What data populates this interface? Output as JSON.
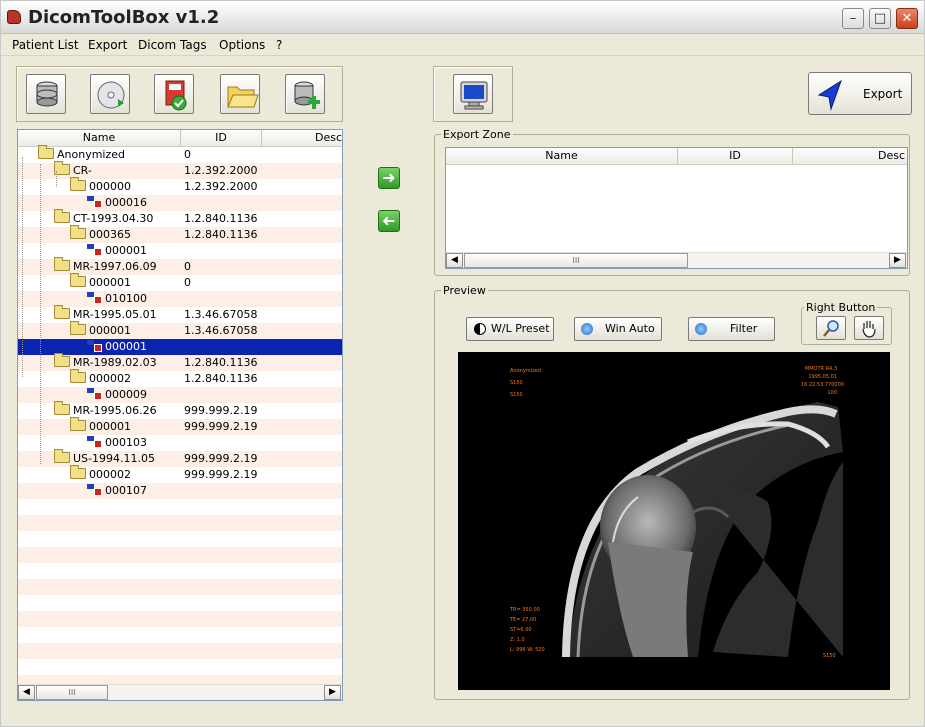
{
  "window": {
    "title": "DicomToolBox v1.2"
  },
  "menu": [
    "Patient List",
    "Export",
    "Dicom Tags",
    "Options",
    "?"
  ],
  "toolbar_icons": [
    "database-icon",
    "cd-icon",
    "import-icon",
    "folder-icon",
    "add-database-icon"
  ],
  "tree": {
    "columns": [
      "Name",
      "ID",
      "Desc"
    ],
    "rows": [
      {
        "name": "Anonymized",
        "id": "0",
        "type": "folder",
        "level": 0
      },
      {
        "name": "CR-",
        "id": "1.2.392.2000...",
        "type": "folder",
        "level": 1
      },
      {
        "name": "000000",
        "id": "1.2.392.2000...",
        "type": "folder",
        "level": 2
      },
      {
        "name": "000016",
        "id": "",
        "type": "dicom",
        "level": 3
      },
      {
        "name": "CT-1993.04.30",
        "id": "1.2.840.1136...",
        "type": "folder",
        "level": 1
      },
      {
        "name": "000365",
        "id": "1.2.840.1136...",
        "type": "folder",
        "level": 2
      },
      {
        "name": "000001",
        "id": "",
        "type": "dicom",
        "level": 3
      },
      {
        "name": "MR-1997.06.09",
        "id": "0",
        "type": "folder",
        "level": 1
      },
      {
        "name": "000001",
        "id": "0",
        "type": "folder",
        "level": 2
      },
      {
        "name": "010100",
        "id": "",
        "type": "dicom",
        "level": 3
      },
      {
        "name": "MR-1995.05.01",
        "id": "1.3.46.67058...",
        "type": "folder",
        "level": 1
      },
      {
        "name": "000001",
        "id": "1.3.46.67058...",
        "type": "folder",
        "level": 2
      },
      {
        "name": "000001",
        "id": "",
        "type": "dicom",
        "level": 3,
        "selected": true
      },
      {
        "name": "MR-1989.02.03",
        "id": "1.2.840.1136...",
        "type": "folder",
        "level": 1
      },
      {
        "name": "000002",
        "id": "1.2.840.1136...",
        "type": "folder",
        "level": 2
      },
      {
        "name": "000009",
        "id": "",
        "type": "dicom",
        "level": 3
      },
      {
        "name": "MR-1995.06.26",
        "id": "999.999.2.19...",
        "type": "folder",
        "level": 1
      },
      {
        "name": "000001",
        "id": "999.999.2.19...",
        "type": "folder",
        "level": 2
      },
      {
        "name": "000103",
        "id": "",
        "type": "dicom",
        "level": 3
      },
      {
        "name": "US-1994.11.05",
        "id": "999.999.2.19...",
        "type": "folder",
        "level": 1
      },
      {
        "name": "000002",
        "id": "999.999.2.19...",
        "type": "folder",
        "level": 2
      },
      {
        "name": "000107",
        "id": "",
        "type": "dicom",
        "level": 3
      }
    ],
    "scroll_thumb": "III"
  },
  "export_button": {
    "label": "Export"
  },
  "export_zone": {
    "label": "Export Zone",
    "columns": [
      "Name",
      "ID",
      "Desc"
    ],
    "scroll_thumb": "III"
  },
  "preview": {
    "label": "Preview",
    "buttons": [
      "W/L Preset",
      "Win Auto",
      "Filter"
    ],
    "right_button_label": "Right Button",
    "right_button_icons": [
      "zoom-icon",
      "hand-icon"
    ],
    "overlay": {
      "top_left": [
        "Anonymized",
        "S150",
        "S150"
      ],
      "top_right": [
        "MMOTR R4.3",
        "1995.05.01",
        "16.22.53.770000",
        "100"
      ],
      "bottom_left": [
        "TR= 350.00",
        "TE= 27.00",
        "ST=6.00",
        "Z: 1.0",
        "L: 996 W: 520"
      ],
      "bottom_right": "S150"
    }
  },
  "colors": {
    "selection": "#0a24b0",
    "alt_row": "#fdeee6",
    "overlay_text": "#f07a1a",
    "panel": "#ece9d8"
  }
}
